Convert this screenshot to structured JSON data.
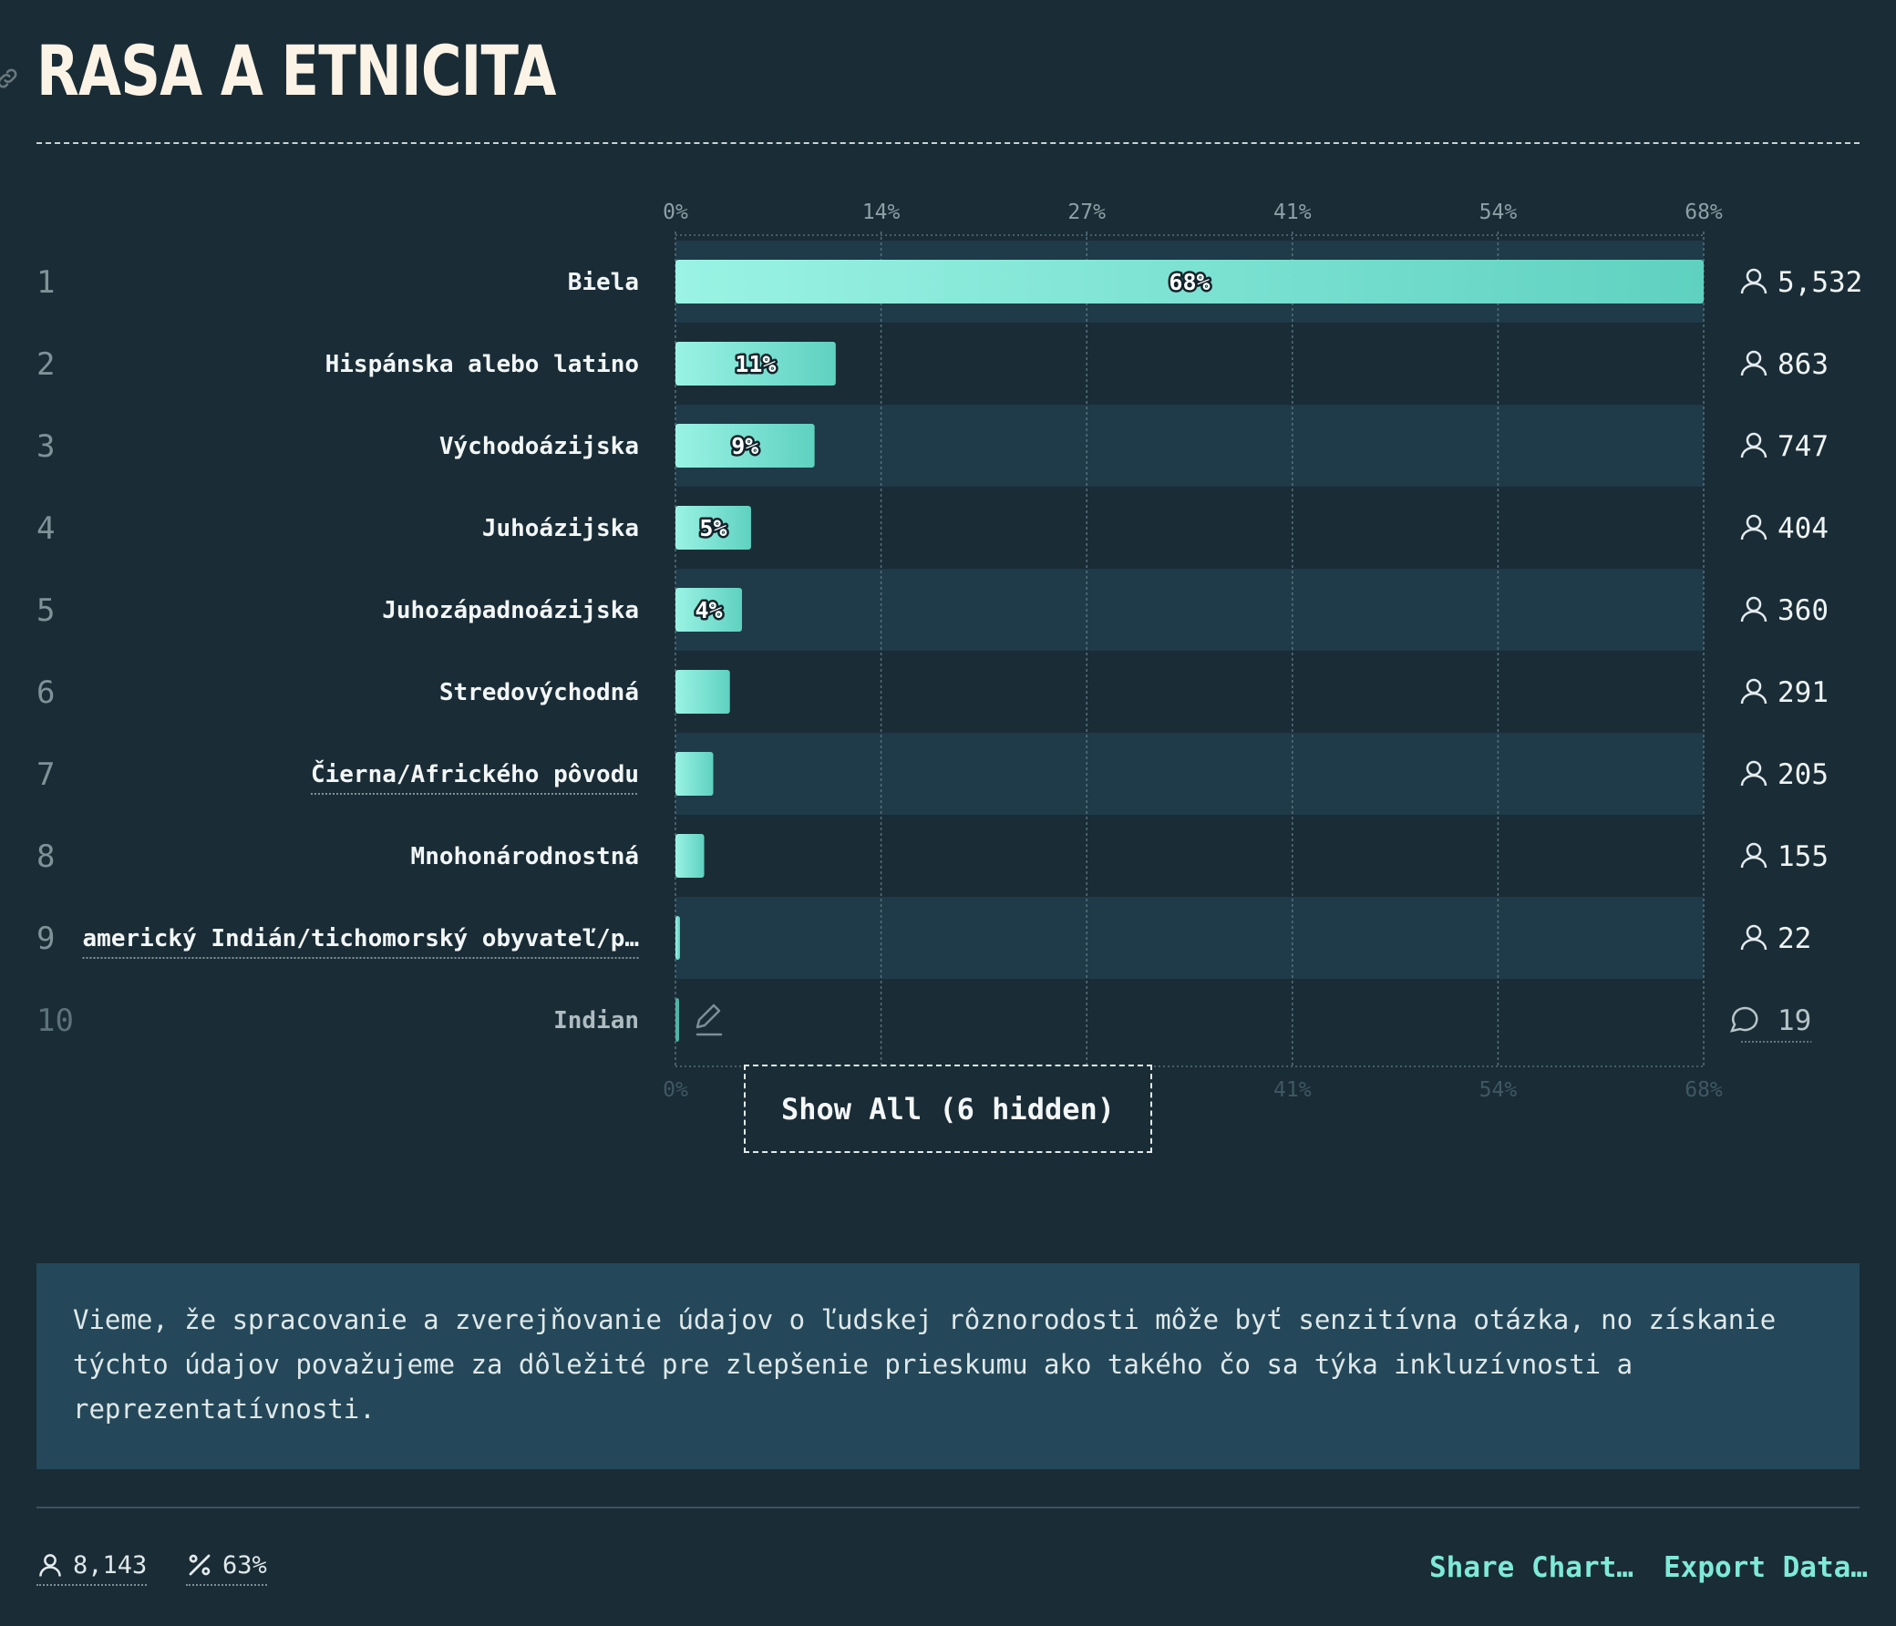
{
  "title": "RASA A ETNICITA",
  "chart_data": {
    "type": "bar",
    "orientation": "horizontal",
    "axis_ticks": [
      "0%",
      "14%",
      "27%",
      "41%",
      "54%",
      "68%"
    ],
    "xlim": [
      0,
      68
    ],
    "rows": [
      {
        "rank": "1",
        "label": "Biela",
        "percent": 68,
        "percent_label": "68%",
        "count": "5,532",
        "icon": "person-icon"
      },
      {
        "rank": "2",
        "label": "Hispánska alebo latino",
        "percent": 10.6,
        "percent_label": "11%",
        "count": "863",
        "icon": "person-icon"
      },
      {
        "rank": "3",
        "label": "Východoázijska",
        "percent": 9.2,
        "percent_label": "9%",
        "count": "747",
        "icon": "person-icon"
      },
      {
        "rank": "4",
        "label": "Juhoázijska",
        "percent": 5.0,
        "percent_label": "5%",
        "count": "404",
        "icon": "person-icon"
      },
      {
        "rank": "5",
        "label": "Juhozápadnoázijska",
        "percent": 4.4,
        "percent_label": "4%",
        "count": "360",
        "icon": "person-icon"
      },
      {
        "rank": "6",
        "label": "Stredovýchodná",
        "percent": 3.6,
        "percent_label": "",
        "count": "291",
        "icon": "person-icon"
      },
      {
        "rank": "7",
        "label": "Čierna/Afrického pôvodu",
        "percent": 2.5,
        "percent_label": "",
        "count": "205",
        "icon": "person-icon",
        "underlined": true
      },
      {
        "rank": "8",
        "label": "Mnohonárodnostná",
        "percent": 1.9,
        "percent_label": "",
        "count": "155",
        "icon": "person-icon"
      },
      {
        "rank": "9",
        "label": "americký Indián/tichomorský obyvateľ/p…",
        "percent": 0.3,
        "percent_label": "",
        "count": "22",
        "icon": "person-icon",
        "underlined": true
      },
      {
        "rank": "10",
        "label": "Indian",
        "percent": 0.2,
        "percent_label": "",
        "count": "19",
        "icon": "comment-icon",
        "dim": true,
        "edit_icon": "pencil-icon"
      }
    ],
    "colors": {
      "bar_start": "#9af3e4",
      "bar_end": "#5fd1c0",
      "band": "#1f3a49",
      "grid": "#56707b"
    }
  },
  "show_all_label": "Show All (6 hidden)",
  "note": "Vieme, že spracovanie a zverejňovanie údajov o ľudskej rôznorodosti môže byť senzitívna otázka, no získanie týchto údajov považujeme za dôležité pre zlepšenie prieskumu ako takého čo sa týka inkluzívnosti a reprezentatívnosti.",
  "footer": {
    "respondents": "8,143",
    "percent": "63%",
    "share_label": "Share Chart…",
    "export_label": "Export Data…"
  }
}
